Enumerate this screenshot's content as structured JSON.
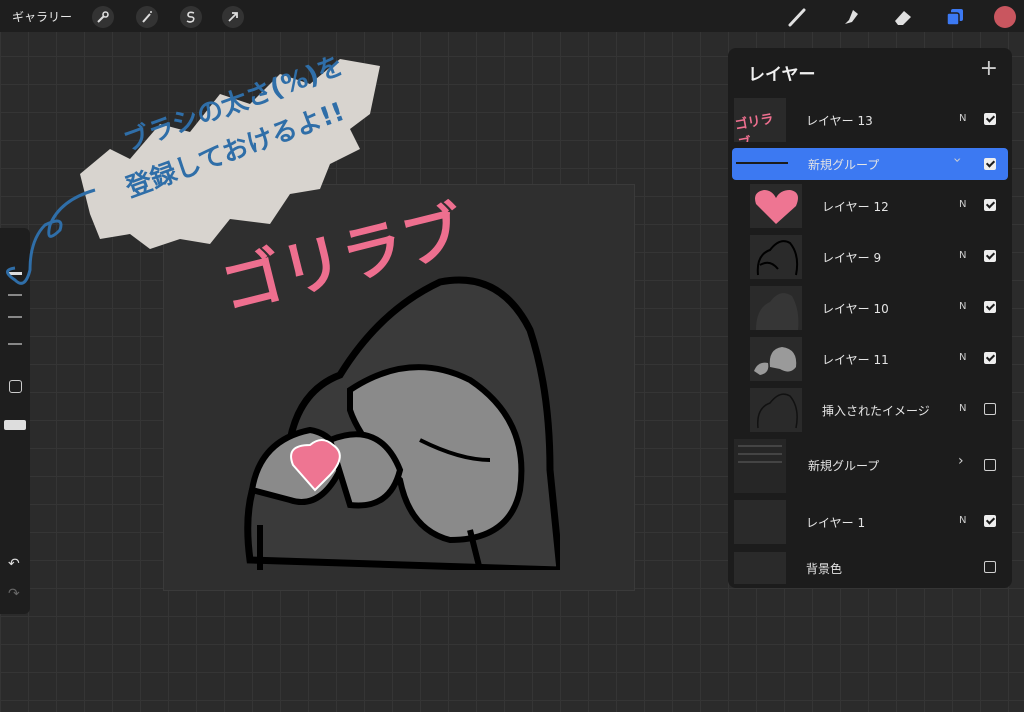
{
  "topbar": {
    "gallery_label": "ギャラリー",
    "left_tools": [
      "wrench-icon",
      "magic-wand-icon",
      "selection-icon",
      "transform-arrow-icon"
    ],
    "right_tools": [
      "brush-icon",
      "smudge-icon",
      "eraser-icon",
      "layers-icon"
    ],
    "active_color": "#c9565f",
    "layers_icon_color": "#3c79f2"
  },
  "canvas": {
    "title_text": "ゴリラブ",
    "title_color": "#ee6f8f",
    "note_line1": "ブラシの太さ(%)を",
    "note_line2": "登録しておけるよ!!",
    "note_color": "#2f6ea8"
  },
  "layers_panel": {
    "title": "レイヤー",
    "add_icon": "plus-icon",
    "rows": [
      {
        "name": "レイヤー 13",
        "blend": "N",
        "checked": true
      },
      {
        "name": "新規グループ",
        "blend": "",
        "checked": true,
        "selected": true
      },
      {
        "name": "レイヤー 12",
        "blend": "N",
        "checked": true
      },
      {
        "name": "レイヤー 9",
        "blend": "N",
        "checked": true
      },
      {
        "name": "レイヤー 10",
        "blend": "N",
        "checked": true
      },
      {
        "name": "レイヤー 11",
        "blend": "N",
        "checked": true
      },
      {
        "name": "挿入されたイメージ",
        "blend": "N",
        "checked": false
      },
      {
        "name": "新規グループ",
        "blend": "",
        "checked": false
      },
      {
        "name": "レイヤー 1",
        "blend": "N",
        "checked": true
      },
      {
        "name": "背景色",
        "blend": "",
        "checked": false
      }
    ],
    "thumb_label_13": "ゴリラブ"
  }
}
